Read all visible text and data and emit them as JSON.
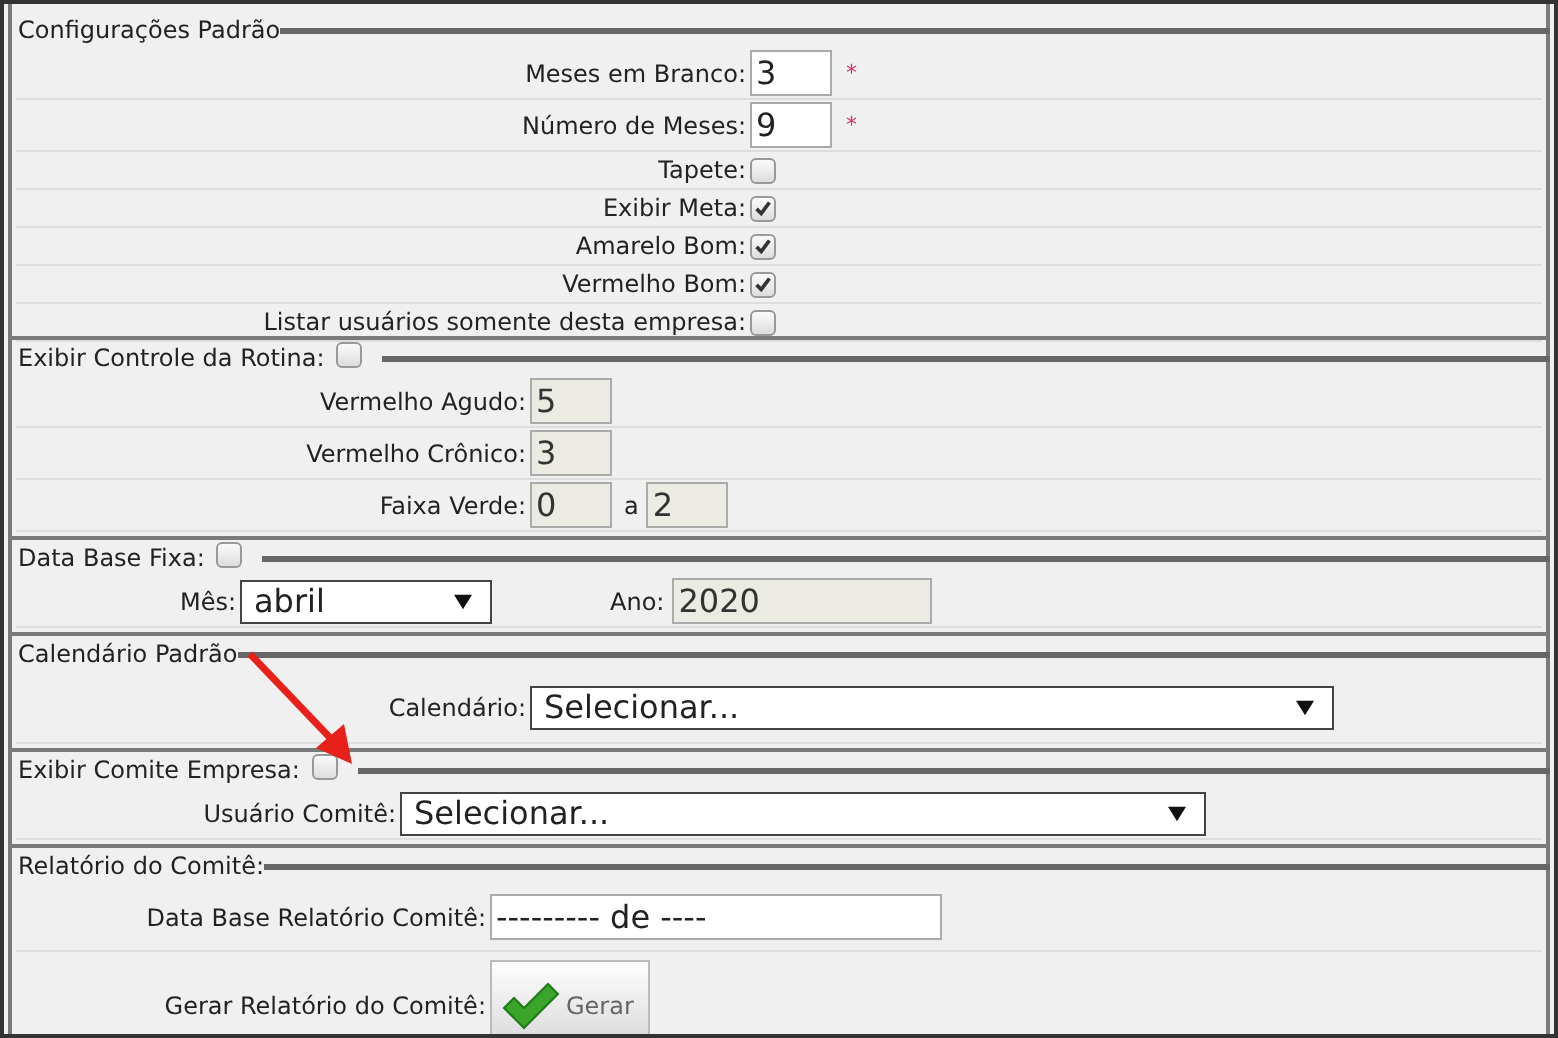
{
  "sections": [
    {
      "title": "Configurações Padrão",
      "rows": [
        {
          "kind": "input",
          "label": "Meses em Branco:",
          "value": "3",
          "readonly": false,
          "required": "*"
        },
        {
          "kind": "input",
          "label": "Número de Meses:",
          "value": "9",
          "readonly": false,
          "required": "*"
        },
        {
          "kind": "checkbox",
          "label": "Tapete:",
          "checked": false
        },
        {
          "kind": "checkbox",
          "label": "Exibir Meta:",
          "checked": true
        },
        {
          "kind": "checkbox",
          "label": "Amarelo Bom:",
          "checked": true
        },
        {
          "kind": "checkbox",
          "label": "Vermelho Bom:",
          "checked": true
        },
        {
          "kind": "checkbox",
          "label": "Listar usuários somente desta empresa:",
          "checked": false
        }
      ]
    },
    {
      "title": "Exibir Controle da Rotina:",
      "header_checked": false,
      "rows": [
        {
          "kind": "input",
          "label": "Vermelho Agudo:",
          "value": "5",
          "readonly": true
        },
        {
          "kind": "input",
          "label": "Vermelho Crônico:",
          "value": "3",
          "readonly": true
        },
        {
          "kind": "range",
          "label": "Faixa Verde:",
          "from": "0",
          "separator": "a",
          "to": "2",
          "readonly": true
        }
      ]
    },
    {
      "title": "Data Base Fixa:",
      "header_checked": false,
      "rows": [
        {
          "kind": "month_year",
          "label": "Mês:",
          "value": "abril",
          "year_label": "Ano:",
          "year": "2020",
          "year_readonly": true
        }
      ]
    },
    {
      "title": "Calendário Padrão",
      "rows": [
        {
          "kind": "select",
          "label": "Calendário:",
          "value": "Selecionar..."
        }
      ]
    },
    {
      "title": "Exibir Comite Empresa:",
      "header_checked": false,
      "rows": [
        {
          "kind": "select",
          "label": "Usuário Comitê:",
          "value": "Selecionar..."
        }
      ]
    },
    {
      "title": "Relatório do Comitê:",
      "rows": [
        {
          "kind": "input",
          "label": "Data Base Relatório Comitê:",
          "value": "--------- de ----",
          "readonly": false
        },
        {
          "kind": "button",
          "label": "Gerar Relatório do Comitê:",
          "button": "Gerar"
        }
      ]
    }
  ],
  "annotations": [
    {
      "kind": "arrow"
    }
  ]
}
